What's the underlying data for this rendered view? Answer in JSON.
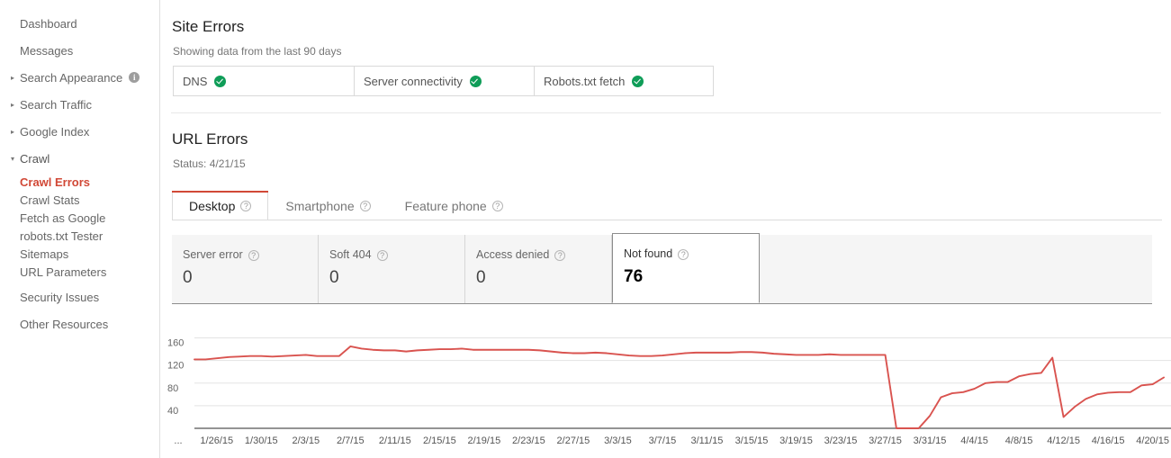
{
  "sidebar": {
    "items": [
      {
        "label": "Dashboard",
        "arrow": "",
        "info": false,
        "type": "top"
      },
      {
        "label": "Messages",
        "arrow": "",
        "info": false,
        "type": "top"
      },
      {
        "label": "Search Appearance",
        "arrow": "▸",
        "info": true,
        "type": "top"
      },
      {
        "label": "Search Traffic",
        "arrow": "▸",
        "info": false,
        "type": "top"
      },
      {
        "label": "Google Index",
        "arrow": "▸",
        "info": false,
        "type": "top"
      },
      {
        "label": "Crawl",
        "arrow": "▾",
        "info": false,
        "type": "top",
        "expanded": true
      }
    ],
    "crawl_children": [
      {
        "label": "Crawl Errors",
        "active": true
      },
      {
        "label": "Crawl Stats",
        "active": false
      },
      {
        "label": "Fetch as Google",
        "active": false
      },
      {
        "label": "robots.txt Tester",
        "active": false
      },
      {
        "label": "Sitemaps",
        "active": false
      },
      {
        "label": "URL Parameters",
        "active": false
      }
    ],
    "after_crawl": [
      {
        "label": "Security Issues"
      },
      {
        "label": "Other Resources"
      }
    ],
    "info_icon_glyph": "i"
  },
  "site_errors": {
    "title": "Site Errors",
    "subtitle": "Showing data from the last 90 days",
    "boxes": [
      {
        "label": "DNS",
        "status": "ok",
        "status_icon": "check-circle-icon"
      },
      {
        "label": "Server connectivity",
        "status": "ok",
        "status_icon": "check-circle-icon"
      },
      {
        "label": "Robots.txt fetch",
        "status": "ok",
        "status_icon": "check-circle-icon"
      }
    ]
  },
  "url_errors": {
    "title": "URL Errors",
    "status_line": "Status: 4/21/15",
    "tabs": [
      {
        "label": "Desktop",
        "help_icon": "question-mark-icon",
        "active": true
      },
      {
        "label": "Smartphone",
        "help_icon": "question-mark-icon",
        "active": false
      },
      {
        "label": "Feature phone",
        "help_icon": "question-mark-icon",
        "active": false
      }
    ],
    "stat_cards": [
      {
        "label": "Server error",
        "value": "0",
        "help_icon": "question-mark-icon",
        "selected": false
      },
      {
        "label": "Soft 404",
        "value": "0",
        "help_icon": "question-mark-icon",
        "selected": false
      },
      {
        "label": "Access denied",
        "value": "0",
        "help_icon": "question-mark-icon",
        "selected": false
      },
      {
        "label": "Not found",
        "value": "76",
        "help_icon": "question-mark-icon",
        "selected": true
      }
    ]
  },
  "colors": {
    "accent_red": "#d14836",
    "chart_line": "#d9534f",
    "status_green": "#0f9d58",
    "active_nav": "#d14836",
    "strip_bg": "#f5f5f5"
  },
  "chart_data": {
    "type": "line",
    "title": "Not found",
    "xlabel": "",
    "ylabel": "",
    "ylim": [
      0,
      180
    ],
    "yticks": [
      160,
      120,
      80,
      40
    ],
    "grid": true,
    "legend": "none",
    "leading_ellipsis": "...",
    "xtick_labels": [
      "1/26/15",
      "1/30/15",
      "2/3/15",
      "2/7/15",
      "2/11/15",
      "2/15/15",
      "2/19/15",
      "2/23/15",
      "2/27/15",
      "3/3/15",
      "3/7/15",
      "3/11/15",
      "3/15/15",
      "3/19/15",
      "3/23/15",
      "3/27/15",
      "3/31/15",
      "4/4/15",
      "4/8/15",
      "4/12/15",
      "4/16/15",
      "4/20/15"
    ],
    "x": [
      "1/24/15",
      "1/25/15",
      "1/26/15",
      "1/27/15",
      "1/28/15",
      "1/29/15",
      "1/30/15",
      "1/31/15",
      "2/1/15",
      "2/2/15",
      "2/3/15",
      "2/4/15",
      "2/5/15",
      "2/6/15",
      "2/7/15",
      "2/8/15",
      "2/9/15",
      "2/10/15",
      "2/11/15",
      "2/12/15",
      "2/13/15",
      "2/14/15",
      "2/15/15",
      "2/16/15",
      "2/17/15",
      "2/18/15",
      "2/19/15",
      "2/20/15",
      "2/21/15",
      "2/22/15",
      "2/23/15",
      "2/24/15",
      "2/25/15",
      "2/26/15",
      "2/27/15",
      "2/28/15",
      "3/1/15",
      "3/2/15",
      "3/3/15",
      "3/4/15",
      "3/5/15",
      "3/6/15",
      "3/7/15",
      "3/8/15",
      "3/9/15",
      "3/10/15",
      "3/11/15",
      "3/12/15",
      "3/13/15",
      "3/14/15",
      "3/15/15",
      "3/16/15",
      "3/17/15",
      "3/18/15",
      "3/19/15",
      "3/20/15",
      "3/21/15",
      "3/22/15",
      "3/23/15",
      "3/24/15",
      "3/25/15",
      "3/26/15",
      "3/27/15",
      "3/28/15",
      "3/29/15",
      "3/30/15",
      "3/31/15",
      "4/1/15",
      "4/2/15",
      "4/3/15",
      "4/4/15",
      "4/5/15",
      "4/6/15",
      "4/7/15",
      "4/8/15",
      "4/9/15",
      "4/10/15",
      "4/11/15",
      "4/12/15",
      "4/13/15",
      "4/14/15",
      "4/15/15",
      "4/16/15",
      "4/17/15",
      "4/18/15",
      "4/19/15",
      "4/20/15",
      "4/21/15"
    ],
    "values": [
      122,
      122,
      124,
      126,
      127,
      128,
      128,
      127,
      128,
      129,
      130,
      128,
      128,
      128,
      145,
      141,
      139,
      138,
      138,
      136,
      138,
      139,
      140,
      140,
      141,
      139,
      139,
      139,
      139,
      139,
      139,
      138,
      136,
      134,
      133,
      133,
      134,
      133,
      131,
      129,
      128,
      128,
      129,
      131,
      133,
      134,
      134,
      134,
      134,
      135,
      135,
      134,
      132,
      131,
      130,
      130,
      130,
      131,
      130,
      130,
      130,
      130,
      130,
      0,
      0,
      0,
      22,
      55,
      62,
      64,
      70,
      80,
      82,
      82,
      92,
      96,
      98,
      125,
      20,
      38,
      52,
      60,
      63,
      64,
      64,
      76,
      78,
      90
    ]
  }
}
